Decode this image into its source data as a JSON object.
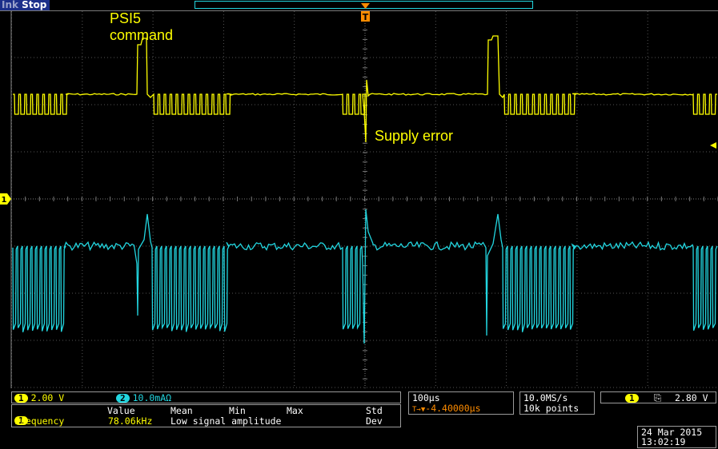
{
  "status": "Stop",
  "annotations": {
    "psi5_line1": "PSI5",
    "psi5_line2": "command",
    "supply_error": "Supply error"
  },
  "markers": {
    "ch1_ground": "1",
    "trigger": "T"
  },
  "channels": {
    "ch1": {
      "id": "1",
      "scale": "2.00 V"
    },
    "ch2": {
      "id": "2",
      "scale": "10.0mAΩ"
    }
  },
  "measurements": {
    "headers": [
      "Value",
      "Mean",
      "Min",
      "Max",
      "Std Dev"
    ],
    "row": {
      "source": "1",
      "name": "Frequency",
      "value": "78.06kHz",
      "note": "Low signal amplitude"
    }
  },
  "timebase": {
    "scale": "100µs",
    "position": "-4.40000µs",
    "position_prefix": "T→▼"
  },
  "acquisition": {
    "rate": "10.0MS/s",
    "points": "10k points"
  },
  "trigger": {
    "source": "1",
    "slope": "⎘",
    "level": "2.80 V"
  },
  "datetime": {
    "date": "24 Mar 2015",
    "time": "13:02:19"
  },
  "colors": {
    "ch1": "#ffff00",
    "ch2": "#22d6e0",
    "status_bg": "#1c2f8a",
    "grid": "#555555"
  }
}
